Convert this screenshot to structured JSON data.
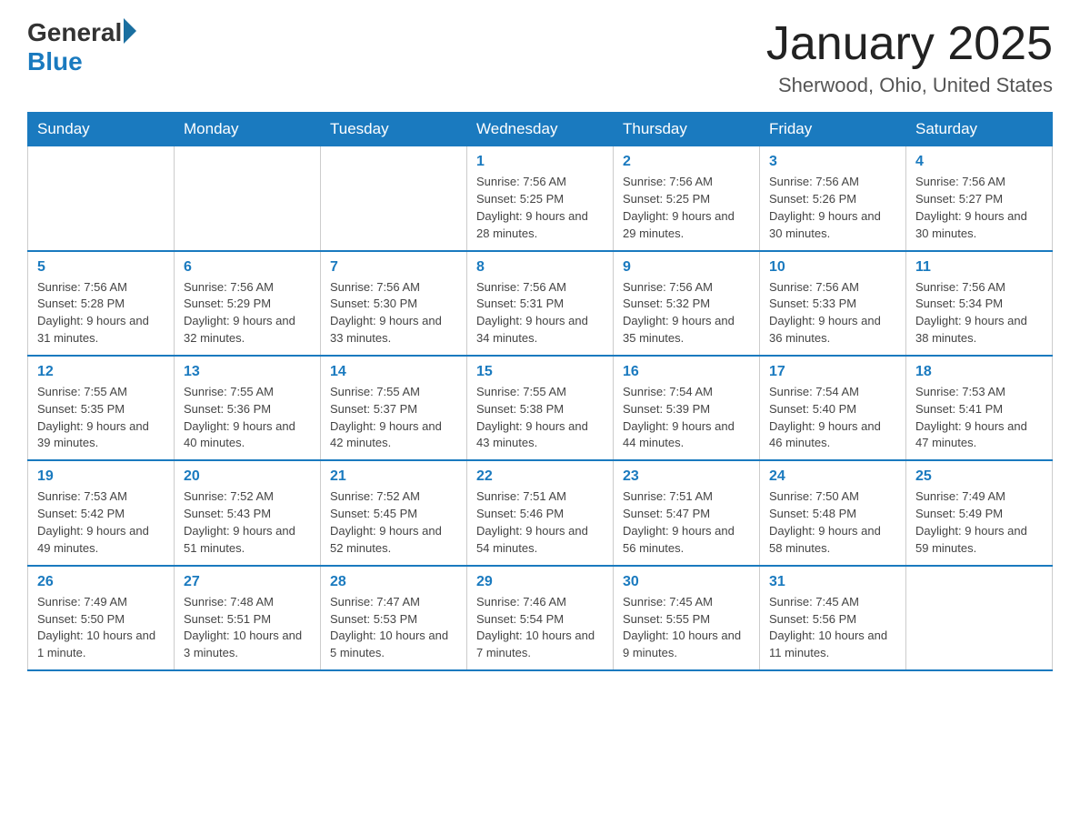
{
  "header": {
    "logo_general": "General",
    "logo_blue": "Blue",
    "month_title": "January 2025",
    "location": "Sherwood, Ohio, United States"
  },
  "weekdays": [
    "Sunday",
    "Monday",
    "Tuesday",
    "Wednesday",
    "Thursday",
    "Friday",
    "Saturday"
  ],
  "weeks": [
    [
      {
        "day": "",
        "info": ""
      },
      {
        "day": "",
        "info": ""
      },
      {
        "day": "",
        "info": ""
      },
      {
        "day": "1",
        "info": "Sunrise: 7:56 AM\nSunset: 5:25 PM\nDaylight: 9 hours and 28 minutes."
      },
      {
        "day": "2",
        "info": "Sunrise: 7:56 AM\nSunset: 5:25 PM\nDaylight: 9 hours and 29 minutes."
      },
      {
        "day": "3",
        "info": "Sunrise: 7:56 AM\nSunset: 5:26 PM\nDaylight: 9 hours and 30 minutes."
      },
      {
        "day": "4",
        "info": "Sunrise: 7:56 AM\nSunset: 5:27 PM\nDaylight: 9 hours and 30 minutes."
      }
    ],
    [
      {
        "day": "5",
        "info": "Sunrise: 7:56 AM\nSunset: 5:28 PM\nDaylight: 9 hours and 31 minutes."
      },
      {
        "day": "6",
        "info": "Sunrise: 7:56 AM\nSunset: 5:29 PM\nDaylight: 9 hours and 32 minutes."
      },
      {
        "day": "7",
        "info": "Sunrise: 7:56 AM\nSunset: 5:30 PM\nDaylight: 9 hours and 33 minutes."
      },
      {
        "day": "8",
        "info": "Sunrise: 7:56 AM\nSunset: 5:31 PM\nDaylight: 9 hours and 34 minutes."
      },
      {
        "day": "9",
        "info": "Sunrise: 7:56 AM\nSunset: 5:32 PM\nDaylight: 9 hours and 35 minutes."
      },
      {
        "day": "10",
        "info": "Sunrise: 7:56 AM\nSunset: 5:33 PM\nDaylight: 9 hours and 36 minutes."
      },
      {
        "day": "11",
        "info": "Sunrise: 7:56 AM\nSunset: 5:34 PM\nDaylight: 9 hours and 38 minutes."
      }
    ],
    [
      {
        "day": "12",
        "info": "Sunrise: 7:55 AM\nSunset: 5:35 PM\nDaylight: 9 hours and 39 minutes."
      },
      {
        "day": "13",
        "info": "Sunrise: 7:55 AM\nSunset: 5:36 PM\nDaylight: 9 hours and 40 minutes."
      },
      {
        "day": "14",
        "info": "Sunrise: 7:55 AM\nSunset: 5:37 PM\nDaylight: 9 hours and 42 minutes."
      },
      {
        "day": "15",
        "info": "Sunrise: 7:55 AM\nSunset: 5:38 PM\nDaylight: 9 hours and 43 minutes."
      },
      {
        "day": "16",
        "info": "Sunrise: 7:54 AM\nSunset: 5:39 PM\nDaylight: 9 hours and 44 minutes."
      },
      {
        "day": "17",
        "info": "Sunrise: 7:54 AM\nSunset: 5:40 PM\nDaylight: 9 hours and 46 minutes."
      },
      {
        "day": "18",
        "info": "Sunrise: 7:53 AM\nSunset: 5:41 PM\nDaylight: 9 hours and 47 minutes."
      }
    ],
    [
      {
        "day": "19",
        "info": "Sunrise: 7:53 AM\nSunset: 5:42 PM\nDaylight: 9 hours and 49 minutes."
      },
      {
        "day": "20",
        "info": "Sunrise: 7:52 AM\nSunset: 5:43 PM\nDaylight: 9 hours and 51 minutes."
      },
      {
        "day": "21",
        "info": "Sunrise: 7:52 AM\nSunset: 5:45 PM\nDaylight: 9 hours and 52 minutes."
      },
      {
        "day": "22",
        "info": "Sunrise: 7:51 AM\nSunset: 5:46 PM\nDaylight: 9 hours and 54 minutes."
      },
      {
        "day": "23",
        "info": "Sunrise: 7:51 AM\nSunset: 5:47 PM\nDaylight: 9 hours and 56 minutes."
      },
      {
        "day": "24",
        "info": "Sunrise: 7:50 AM\nSunset: 5:48 PM\nDaylight: 9 hours and 58 minutes."
      },
      {
        "day": "25",
        "info": "Sunrise: 7:49 AM\nSunset: 5:49 PM\nDaylight: 9 hours and 59 minutes."
      }
    ],
    [
      {
        "day": "26",
        "info": "Sunrise: 7:49 AM\nSunset: 5:50 PM\nDaylight: 10 hours and 1 minute."
      },
      {
        "day": "27",
        "info": "Sunrise: 7:48 AM\nSunset: 5:51 PM\nDaylight: 10 hours and 3 minutes."
      },
      {
        "day": "28",
        "info": "Sunrise: 7:47 AM\nSunset: 5:53 PM\nDaylight: 10 hours and 5 minutes."
      },
      {
        "day": "29",
        "info": "Sunrise: 7:46 AM\nSunset: 5:54 PM\nDaylight: 10 hours and 7 minutes."
      },
      {
        "day": "30",
        "info": "Sunrise: 7:45 AM\nSunset: 5:55 PM\nDaylight: 10 hours and 9 minutes."
      },
      {
        "day": "31",
        "info": "Sunrise: 7:45 AM\nSunset: 5:56 PM\nDaylight: 10 hours and 11 minutes."
      },
      {
        "day": "",
        "info": ""
      }
    ]
  ]
}
